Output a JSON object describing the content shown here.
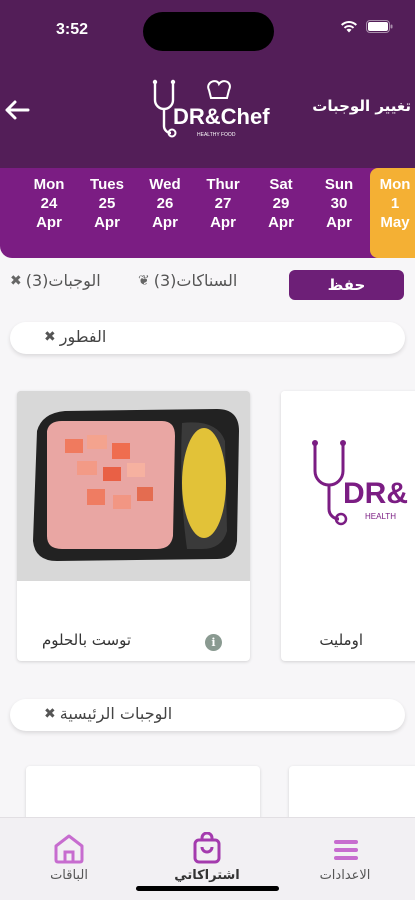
{
  "status_bar": {
    "time": "3:52"
  },
  "header": {
    "back_icon": "back-arrow-icon",
    "logo_text": "DR&Chef",
    "logo_tagline": "HEALTHY FOOD",
    "change_meals_label": "تغيير الوجبات"
  },
  "dates": [
    {
      "day": "Mon",
      "num": "24",
      "month": "Apr",
      "active": false
    },
    {
      "day": "Tues",
      "num": "25",
      "month": "Apr",
      "active": false
    },
    {
      "day": "Wed",
      "num": "26",
      "month": "Apr",
      "active": false
    },
    {
      "day": "Thur",
      "num": "27",
      "month": "Apr",
      "active": false
    },
    {
      "day": "Sat",
      "num": "29",
      "month": "Apr",
      "active": false
    },
    {
      "day": "Sun",
      "num": "30",
      "month": "Apr",
      "active": false
    },
    {
      "day": "Mon",
      "num": "1",
      "month": "May",
      "active": true
    }
  ],
  "filters": {
    "save_label": "حفظ",
    "snacks_label": "السناكات(3)",
    "meals_label": "الوجبات(3)"
  },
  "sections": {
    "breakfast": "الفطور",
    "main_meals": "الوجبات الرئيسية"
  },
  "breakfast_items": [
    {
      "name": "اومليت"
    },
    {
      "name": "توست بالحلوم"
    }
  ],
  "tabs": {
    "settings": "الاعدادات",
    "subscriptions": "اشتراكاتي",
    "packages": "الباقات"
  },
  "colors": {
    "header_bg": "#531e58",
    "dates_bg": "#7b1d83",
    "active_date": "#f4b034",
    "save_button": "#6d1f77",
    "tab_icon": "#c76ccf"
  }
}
